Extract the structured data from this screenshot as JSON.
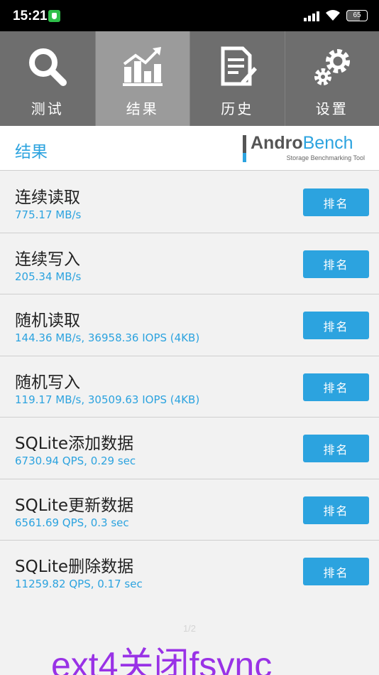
{
  "status_bar": {
    "time": "15:21",
    "battery_percent": "65",
    "battery_level": 0.65,
    "icons": [
      "security-shield-icon",
      "signal-icon",
      "wifi-icon",
      "battery-icon"
    ]
  },
  "tabs": [
    {
      "label": "测试",
      "icon": "magnifier-icon",
      "active": false
    },
    {
      "label": "结果",
      "icon": "bar-chart-icon",
      "active": true
    },
    {
      "label": "历史",
      "icon": "document-pencil-icon",
      "active": false
    },
    {
      "label": "设置",
      "icon": "gears-icon",
      "active": false
    }
  ],
  "header": {
    "title": "结果",
    "logo_andro": "Andro",
    "logo_bench": "Bench",
    "logo_subtitle": "Storage Benchmarking Tool"
  },
  "results": [
    {
      "title": "连续读取",
      "value": "775.17 MB/s",
      "button": "排名"
    },
    {
      "title": "连续写入",
      "value": "205.34 MB/s",
      "button": "排名"
    },
    {
      "title": "随机读取",
      "value": "144.36 MB/s, 36958.36 IOPS (4KB)",
      "button": "排名"
    },
    {
      "title": "随机写入",
      "value": "119.17 MB/s, 30509.63 IOPS (4KB)",
      "button": "排名"
    },
    {
      "title": "SQLite添加数据",
      "value": "6730.94 QPS, 0.29 sec",
      "button": "排名"
    },
    {
      "title": "SQLite更新数据",
      "value": "6561.69 QPS, 0.3 sec",
      "button": "排名"
    },
    {
      "title": "SQLite删除数据",
      "value": "11259.82 QPS, 0.17 sec",
      "button": "排名"
    }
  ],
  "page_indicator": "1/2",
  "watermark": "ext4关闭fsync",
  "colors": {
    "accent": "#2ca3df",
    "tab_bg": "#6e6e6e",
    "tab_active_bg": "#9b9b9b",
    "watermark": "#9932e6"
  }
}
